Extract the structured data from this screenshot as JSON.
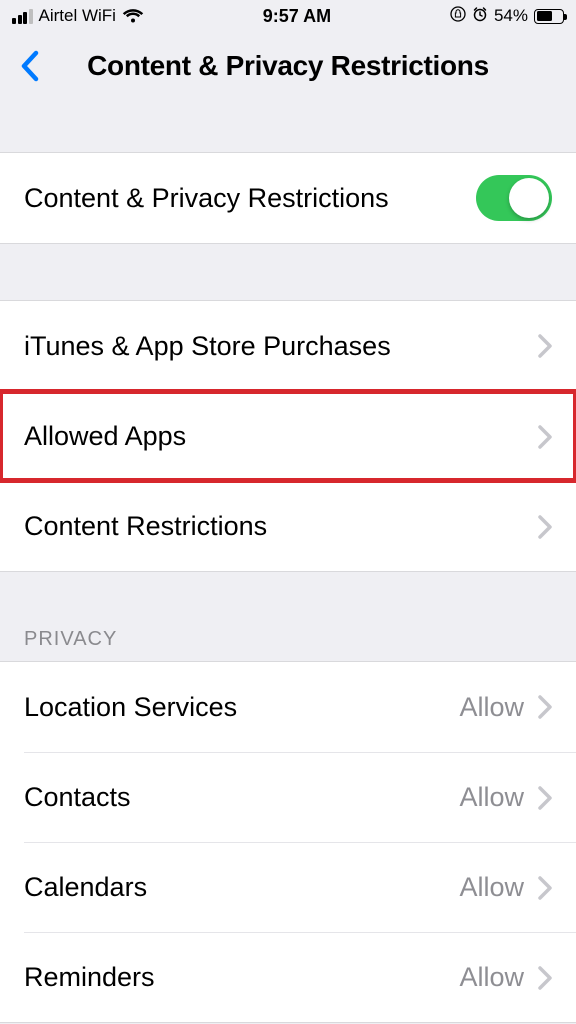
{
  "status": {
    "carrier": "Airtel WiFi",
    "time": "9:57 AM",
    "battery_pct": "54%"
  },
  "header": {
    "title": "Content & Privacy Restrictions"
  },
  "main_toggle": {
    "label": "Content & Privacy Restrictions",
    "on": true
  },
  "rows": {
    "itunes": "iTunes & App Store Purchases",
    "allowed_apps": "Allowed Apps",
    "content_restrictions": "Content Restrictions"
  },
  "privacy": {
    "header": "PRIVACY",
    "items": [
      {
        "label": "Location Services",
        "value": "Allow"
      },
      {
        "label": "Contacts",
        "value": "Allow"
      },
      {
        "label": "Calendars",
        "value": "Allow"
      },
      {
        "label": "Reminders",
        "value": "Allow"
      }
    ]
  }
}
